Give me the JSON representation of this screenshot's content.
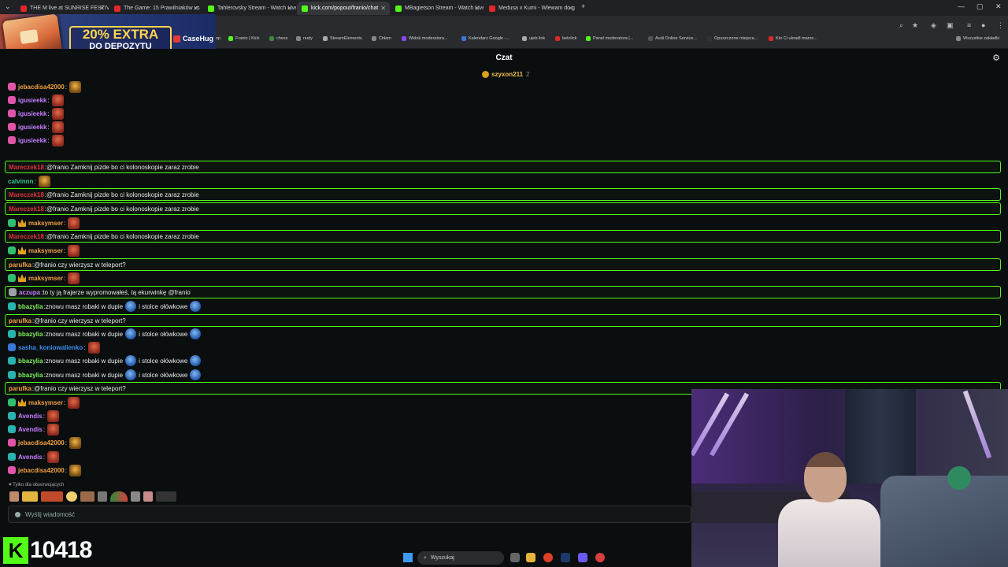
{
  "browser": {
    "tabs": [
      {
        "title": "THE M live at SUNRISE FESTIVAL",
        "color": "#e02828",
        "active": false
      },
      {
        "title": "The Game: 15 Prawilniaków vs",
        "color": "#e02828",
        "active": false
      },
      {
        "title": "Tahlerovsky Stream - Watch Live",
        "color": "#53fc18",
        "active": false
      },
      {
        "title": "kick.com/popout/franio/chat",
        "color": "#53fc18",
        "active": true
      },
      {
        "title": "MBagietson Stream - Watch Live",
        "color": "#53fc18",
        "active": false
      },
      {
        "title": "Medusa x Kumi - Wlewam do g",
        "color": "#e02828",
        "active": false
      }
    ],
    "bookmarks": [
      "Franio | Kick",
      "chess",
      "nudy",
      "StreamElements",
      "Chłam",
      "Widok moderatora...",
      "Kalendarz Google -...",
      "ujeb link",
      "betclick",
      "Panel moderatora |...",
      "Audi Online Service...",
      "Opuszczone miejsca...",
      "Kto Ci ukradł marze...",
      "Wszystkie zakładki"
    ],
    "bookmark_fragment": "op"
  },
  "promo": {
    "line1": "20% EXTRA",
    "line2": "DO DEPOZYTU",
    "brand": "CaseHug"
  },
  "chat": {
    "title": "Czat",
    "pinned": {
      "user": "szyxon211",
      "count": "2"
    },
    "messages": [
      {
        "user": "jebacdisa42000",
        "color": "#f0a040",
        "badge": "pink",
        "text": "",
        "emotes": [
          "gold"
        ],
        "hl": false
      },
      {
        "user": "igusieekk",
        "color": "#c77dff",
        "badge": "pink",
        "text": "",
        "emotes": [
          "red"
        ],
        "hl": false
      },
      {
        "user": "igusieekk",
        "color": "#c77dff",
        "badge": "pink",
        "text": "",
        "emotes": [
          "red"
        ],
        "hl": false
      },
      {
        "user": "igusieekk",
        "color": "#c77dff",
        "badge": "pink",
        "text": "",
        "emotes": [
          "red"
        ],
        "hl": false
      },
      {
        "user": "igusieekk",
        "color": "#c77dff",
        "badge": "pink",
        "text": "",
        "emotes": [
          "red"
        ],
        "hl": false
      },
      {
        "user": "igusieekk",
        "color": "#c77dff",
        "badge": "pink",
        "text": "",
        "emotes": [
          "red"
        ],
        "hl": false
      },
      {
        "user": "Mareczek18",
        "color": "#e0303c",
        "badge": "",
        "text": "@franio Zamknij pizde bo ci kolonoskopie zaraz zrobie",
        "emotes": [],
        "hl": true
      },
      {
        "user": "calvinnn",
        "color": "#2fc58a",
        "badge": "",
        "text": "",
        "emotes": [
          "gold"
        ],
        "hl": false
      },
      {
        "user": "Mareczek18",
        "color": "#e0303c",
        "badge": "",
        "text": "@franio Zamknij pizde bo ci kolonoskopie zaraz zrobie",
        "emotes": [],
        "hl": true
      },
      {
        "user": "Mareczek18",
        "color": "#e0303c",
        "badge": "",
        "text": "@franio Zamknij pizde bo ci kolonoskopie zaraz zrobie",
        "emotes": [],
        "hl": true
      },
      {
        "user": "maksymser",
        "color": "#f0a040",
        "badge": "green-crown",
        "text": "",
        "emotes": [
          "red"
        ],
        "hl": false
      },
      {
        "user": "Mareczek18",
        "color": "#e0303c",
        "badge": "",
        "text": "@franio Zamknij pizde bo ci kolonoskopie zaraz zrobie",
        "emotes": [],
        "hl": true
      },
      {
        "user": "maksymser",
        "color": "#f0a040",
        "badge": "green-crown",
        "text": "",
        "emotes": [
          "red"
        ],
        "hl": false
      },
      {
        "user": "parufka",
        "color": "#f0a040",
        "badge": "",
        "text": "@franio czy wierzysz w teleport?",
        "emotes": [],
        "hl": true
      },
      {
        "user": "maksymser",
        "color": "#f0a040",
        "badge": "green-crown",
        "text": "",
        "emotes": [
          "red"
        ],
        "hl": false
      },
      {
        "user": "aczupa",
        "color": "#c77dff",
        "badge": "gray",
        "text": "to ty ją frajerze wypromowałeś, tą ekurwinkę @franio",
        "emotes": [],
        "hl": true
      },
      {
        "user": "bbazylia",
        "color": "#7ef05a",
        "badge": "teal",
        "text": "znowu masz robaki w dupie",
        "text2": "i stolce ołówkowe",
        "emotes": [
          "blue",
          "blue"
        ],
        "hl": false
      },
      {
        "user": "parufka",
        "color": "#f0a040",
        "badge": "",
        "text": "@franio czy wierzysz w teleport?",
        "emotes": [],
        "hl": true
      },
      {
        "user": "bbazylia",
        "color": "#7ef05a",
        "badge": "teal",
        "text": "znowu masz robaki w dupie",
        "text2": "i stolce ołówkowe",
        "emotes": [
          "blue",
          "blue"
        ],
        "hl": false
      },
      {
        "user": "sasha_koniowalienko",
        "color": "#3a8ef0",
        "badge": "blue",
        "text": "",
        "emotes": [
          "red"
        ],
        "hl": false
      },
      {
        "user": "bbazylia",
        "color": "#7ef05a",
        "badge": "teal",
        "text": "znowu masz robaki w dupie",
        "text2": "i stolce ołówkowe",
        "emotes": [
          "blue",
          "blue"
        ],
        "hl": false
      },
      {
        "user": "bbazylia",
        "color": "#7ef05a",
        "badge": "teal",
        "text": "znowu masz robaki w dupie",
        "text2": "i stolce ołówkowe",
        "emotes": [
          "blue",
          "blue"
        ],
        "hl": false
      },
      {
        "user": "parufka",
        "color": "#f0a040",
        "badge": "",
        "text": "@franio czy wierzysz w teleport?",
        "emotes": [],
        "hl": true
      },
      {
        "user": "maksymser",
        "color": "#f0a040",
        "badge": "green-crown",
        "text": "",
        "emotes": [
          "red"
        ],
        "hl": false
      },
      {
        "user": "Avendis",
        "color": "#c77dff",
        "badge": "teal",
        "text": "",
        "emotes": [
          "red"
        ],
        "hl": false
      },
      {
        "user": "Avendis",
        "color": "#c77dff",
        "badge": "teal",
        "text": "",
        "emotes": [
          "red"
        ],
        "hl": false
      },
      {
        "user": "jebacdisa42000",
        "color": "#f0a040",
        "badge": "pink",
        "text": "",
        "emotes": [
          "gold"
        ],
        "hl": false
      },
      {
        "user": "Avendis",
        "color": "#c77dff",
        "badge": "teal",
        "text": "",
        "emotes": [
          "red"
        ],
        "hl": false
      },
      {
        "user": "jebacdisa42000",
        "color": "#f0a040",
        "badge": "pink",
        "text": "",
        "emotes": [
          "gold"
        ],
        "hl": false
      }
    ],
    "followers_only": "Tylko dla obserwujących",
    "input_placeholder": "Wyślij wiadomość"
  },
  "viewers": {
    "logo": "K",
    "count": "10418"
  },
  "taskbar": {
    "search": "Wyszukaj"
  }
}
